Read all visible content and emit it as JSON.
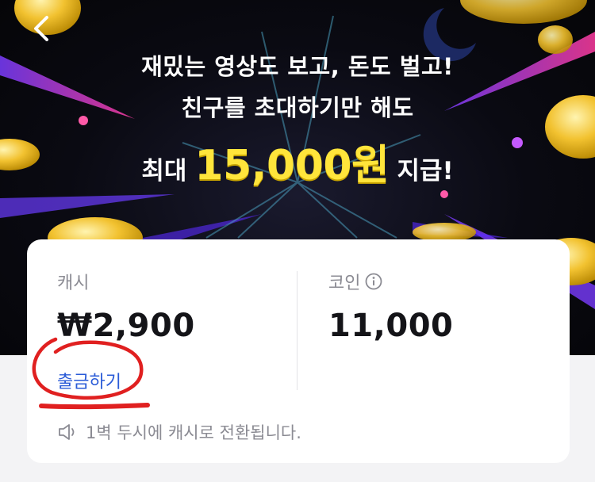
{
  "banner": {
    "line1": "재밌는 영상도 보고, 돈도 벌고!",
    "line2": "친구를 초대하기만 해도",
    "line3_prefix": "최대",
    "line3_amount": "15,000원",
    "line3_suffix": "지급!"
  },
  "wallet": {
    "cash_label": "캐시",
    "cash_value": "₩2,900",
    "withdraw_label": "출금하기",
    "coin_label": "코인",
    "coin_value": "11,000",
    "notice": "1벽 두시에 캐시로 전환됩니다."
  },
  "colors": {
    "accent_yellow": "#ffe53b",
    "link_blue": "#2a5bd7",
    "annotation_red": "#e02020"
  },
  "icons": {
    "back": "chevron-left-icon",
    "info": "info-circle-icon",
    "speaker": "speaker-icon"
  }
}
